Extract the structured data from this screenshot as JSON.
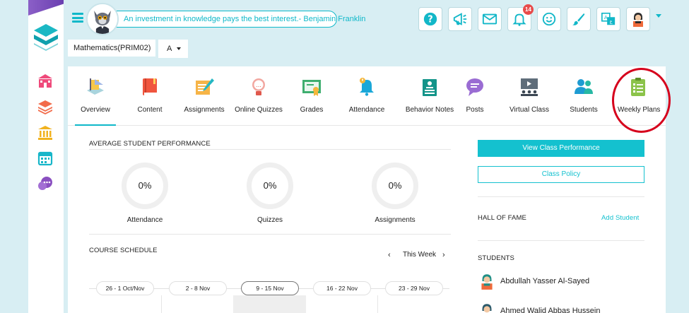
{
  "header": {
    "quote": "An investment in knowledge pays the best interest.- Benjamin Franklin",
    "notification_count": "14",
    "top_icons": [
      "help-icon",
      "announcement-icon",
      "mail-icon",
      "bell-icon",
      "smiley-icon",
      "brush-icon",
      "translate-icon",
      "profile-avatar"
    ]
  },
  "course": {
    "name": "Mathematics(PRIM02)",
    "section": "A"
  },
  "sidebar": {
    "icons": [
      "school-icon",
      "layers-icon",
      "institution-icon",
      "calendar-icon",
      "chat-icon"
    ]
  },
  "tabs": [
    {
      "label": "Overview",
      "icon": "overview-icon",
      "active": true
    },
    {
      "label": "Content",
      "icon": "book-icon"
    },
    {
      "label": "Assignments",
      "icon": "assignment-icon"
    },
    {
      "label": "Online Quizzes",
      "icon": "quiz-icon"
    },
    {
      "label": "Grades",
      "icon": "certificate-icon"
    },
    {
      "label": "Attendance",
      "icon": "alarm-bell-icon"
    },
    {
      "label": "Behavior Notes",
      "icon": "clipboard-icon"
    },
    {
      "label": "Posts",
      "icon": "speech-bubble-icon"
    },
    {
      "label": "Virtual Class",
      "icon": "virtual-class-icon"
    },
    {
      "label": "Students",
      "icon": "students-icon"
    },
    {
      "label": "Weekly Plans",
      "icon": "weekly-plan-icon"
    }
  ],
  "performance": {
    "title": "AVERAGE STUDENT PERFORMANCE",
    "metrics": [
      {
        "label": "Attendance",
        "value": "0%"
      },
      {
        "label": "Quizzes",
        "value": "0%"
      },
      {
        "label": "Assignments",
        "value": "0%"
      }
    ]
  },
  "schedule": {
    "title": "COURSE SCHEDULE",
    "week_label": "This Week",
    "prev": "‹",
    "next": "›",
    "weeks": [
      "26 - 1 Oct/Nov",
      "2 - 8 Nov",
      "9 - 15 Nov",
      "16 - 22 Nov",
      "23 - 29 Nov"
    ]
  },
  "right": {
    "view_performance": "View Class Performance",
    "class_policy": "Class Policy",
    "hall_of_fame": "HALL OF FAME",
    "add_student": "Add Student",
    "students_title": "STUDENTS",
    "students": [
      "Abdullah Yasser Al-Sayed",
      "Ahmed Walid Abbas Hussein"
    ]
  },
  "colors": {
    "accent": "#14c1cf",
    "highlight_circle": "#d6001c",
    "badge": "#e84b4b"
  }
}
